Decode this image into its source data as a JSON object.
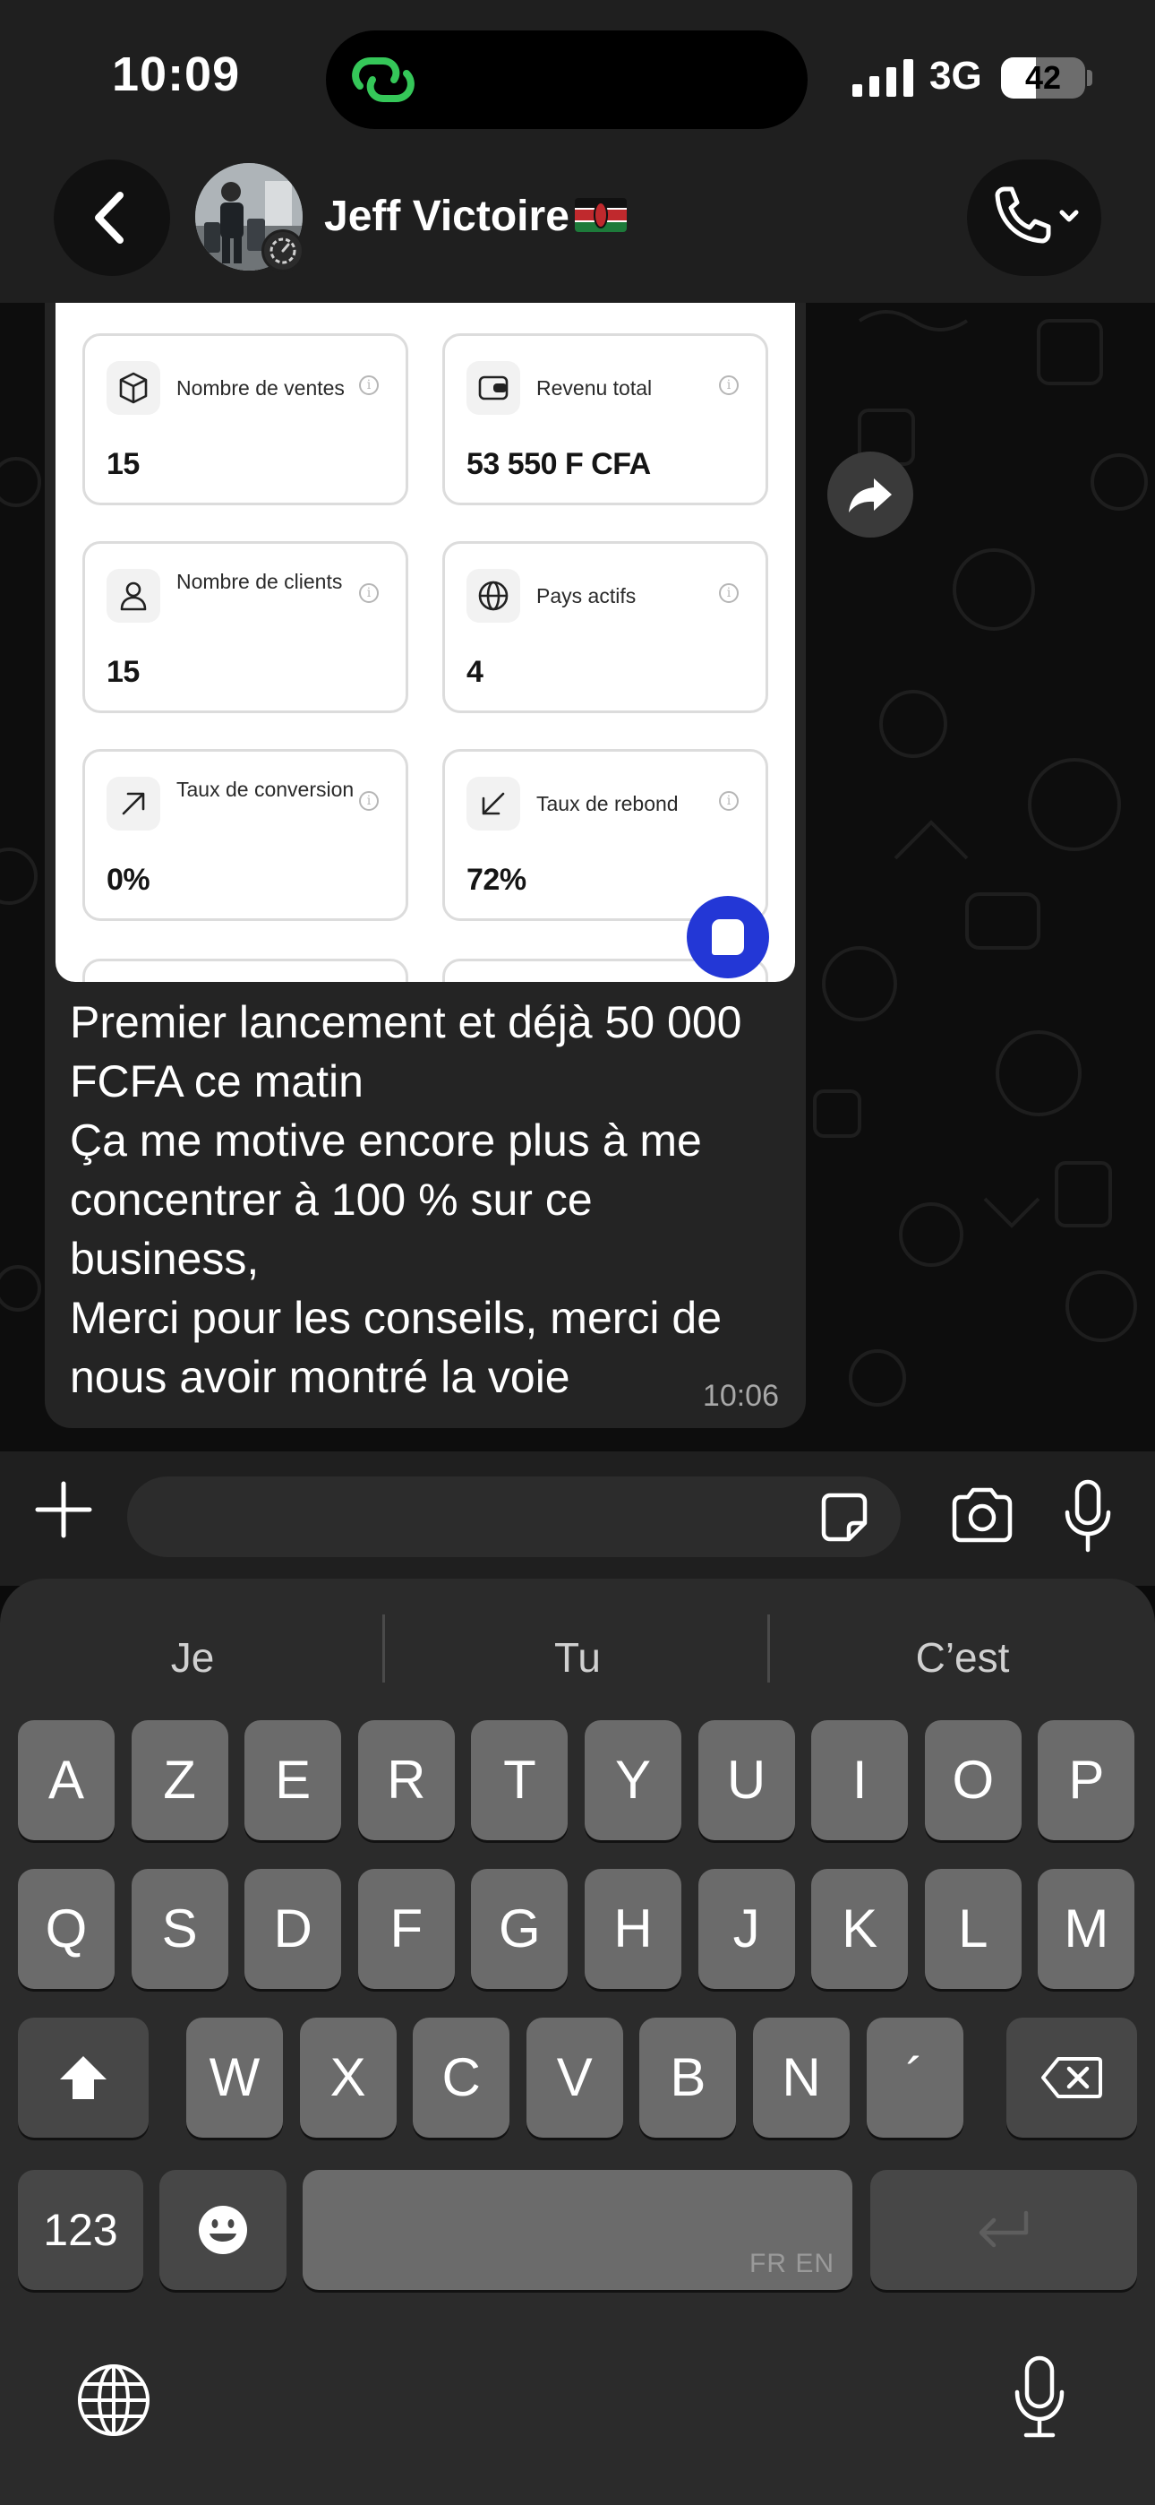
{
  "status_bar": {
    "time": "10:09",
    "network": "3G",
    "battery": "42",
    "battery_level": 0.42
  },
  "header": {
    "contact_name": "Jeff Victoire",
    "flag_icon": "kenya-flag-icon"
  },
  "message": {
    "dashboard": {
      "cards": [
        {
          "label": "Nombre de ventes",
          "value": "15",
          "icon": "cube-icon"
        },
        {
          "label": "Revenu total",
          "value": "53 550 F CFA",
          "icon": "wallet-icon"
        },
        {
          "label": "Nombre de clients",
          "value": "15",
          "icon": "user-icon"
        },
        {
          "label": "Pays actifs",
          "value": "4",
          "icon": "globe-icon"
        },
        {
          "label": "Taux de conversion",
          "value": "0%",
          "icon": "arrow-up-right-icon"
        },
        {
          "label": "Taux de rebond",
          "value": "72%",
          "icon": "arrow-down-left-icon"
        }
      ],
      "info_glyph": "i"
    },
    "lines": [
      "Premier lancement et déjà 50 000",
      "FCFA ce matin",
      "Ça me motive encore plus à me",
      "concentrer à 100 % sur ce",
      "business,",
      "Merci pour les conseils, merci de",
      "nous avoir montré la voie"
    ],
    "time": "10:06"
  },
  "composer": {
    "placeholder": "",
    "value": ""
  },
  "keyboard": {
    "suggestions": [
      "Je",
      "Tu",
      "C’est"
    ],
    "row1": [
      "A",
      "Z",
      "E",
      "R",
      "T",
      "Y",
      "U",
      "I",
      "O",
      "P"
    ],
    "row2": [
      "Q",
      "S",
      "D",
      "F",
      "G",
      "H",
      "J",
      "K",
      "L",
      "M"
    ],
    "row3": [
      "W",
      "X",
      "C",
      "V",
      "B",
      "N",
      "´"
    ],
    "numbers_label": "123",
    "space_hint": "FR EN"
  },
  "colors": {
    "accent_blue": "#2337d6",
    "bubble": "#242424",
    "header": "#1f1f1f",
    "key": "#6b6b6b",
    "key_dark": "#474747",
    "status_green": "#35c759"
  }
}
